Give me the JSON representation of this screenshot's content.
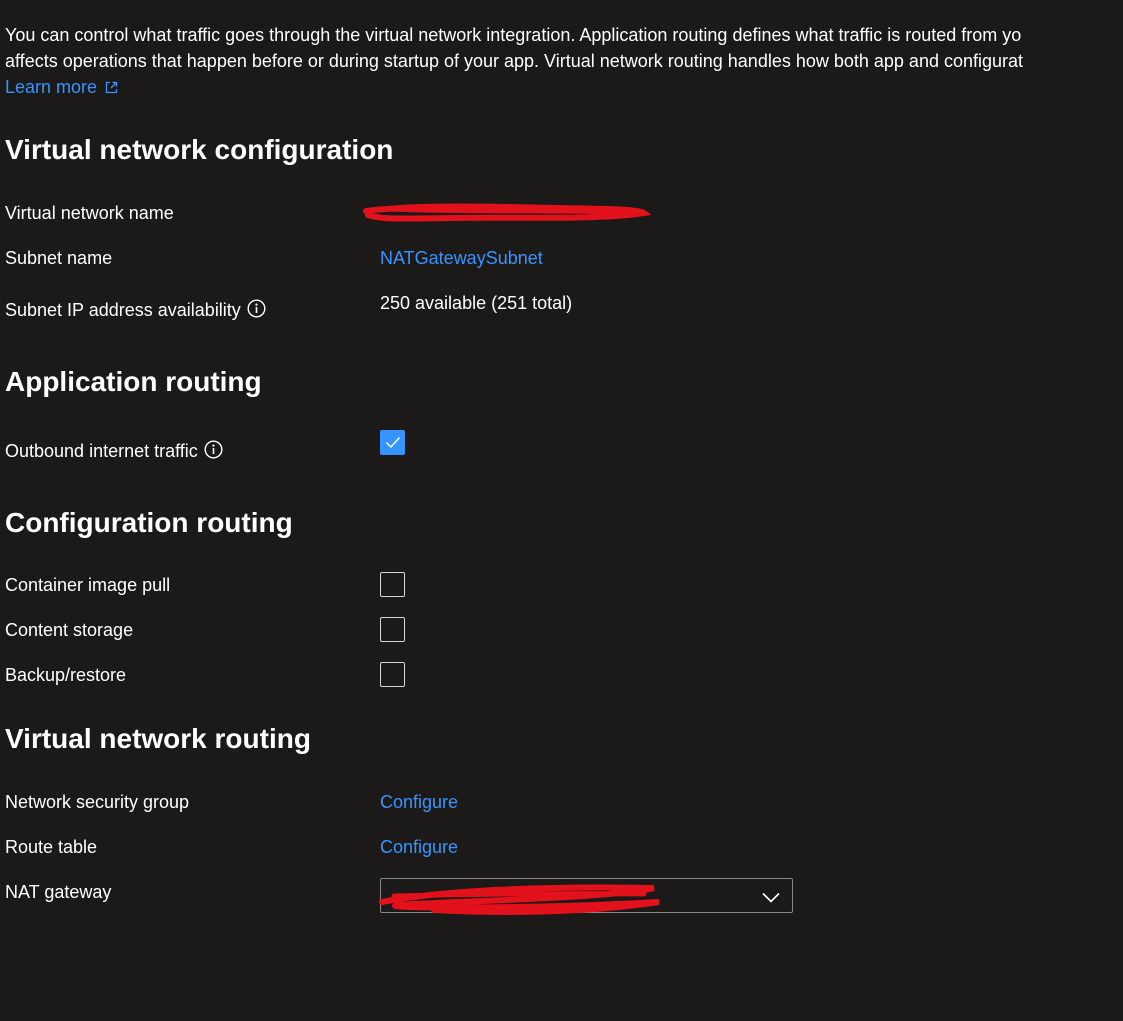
{
  "intro": {
    "line1": "You can control what traffic goes through the virtual network integration. Application routing defines what traffic is routed from yo",
    "line2": "affects operations that happen before or during startup of your app. Virtual network routing handles how both app and configurat",
    "learn_more": "Learn more"
  },
  "vnet_config": {
    "title": "Virtual network configuration",
    "vnet_name_label": "Virtual network name",
    "subnet_name_label": "Subnet name",
    "subnet_name_value": "NATGatewaySubnet",
    "ip_avail_label": "Subnet IP address availability",
    "ip_avail_value": "250 available (251 total)"
  },
  "app_routing": {
    "title": "Application routing",
    "outbound_label": "Outbound internet traffic",
    "outbound_checked": true
  },
  "config_routing": {
    "title": "Configuration routing",
    "items": [
      {
        "label": "Container image pull",
        "checked": false
      },
      {
        "label": "Content storage",
        "checked": false
      },
      {
        "label": "Backup/restore",
        "checked": false
      }
    ]
  },
  "vnet_routing": {
    "title": "Virtual network routing",
    "nsg_label": "Network security group",
    "nsg_action": "Configure",
    "route_table_label": "Route table",
    "route_table_action": "Configure",
    "nat_label": "NAT gateway"
  },
  "colors": {
    "background": "#1b1a19",
    "link": "#3794ff",
    "checkbox_checked": "#3794ff",
    "redaction": "#e3111b"
  },
  "icons": {
    "info": "info-icon",
    "external": "external-link-icon",
    "chevron": "chevron-down-icon",
    "check": "checkmark-icon"
  }
}
